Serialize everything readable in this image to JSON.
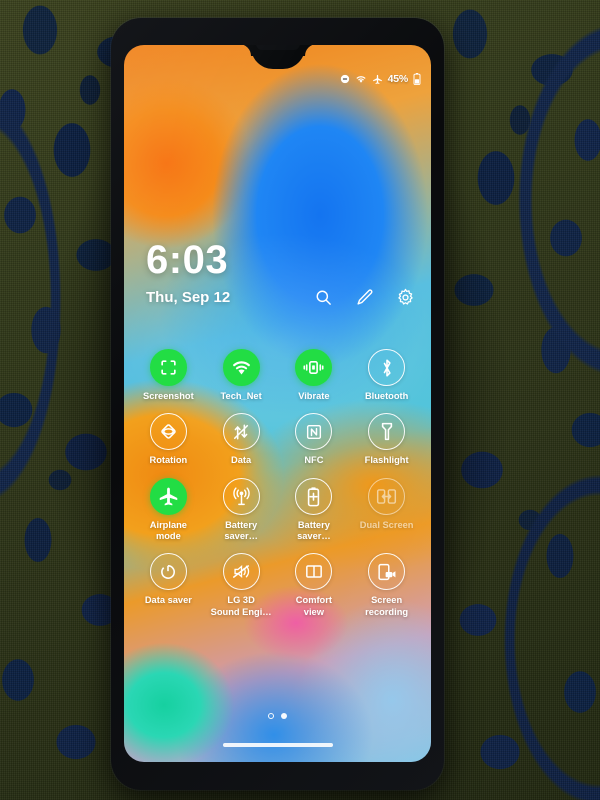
{
  "scene": {
    "description": "photo-of-phone-on-patterned-fabric",
    "background_colors": {
      "olive": "#333b1b",
      "navy": "#102346"
    }
  },
  "device": {
    "body_color": "#0b0d10",
    "notch_type": "waterdrop-notch"
  },
  "statusbar": {
    "icons": [
      "dnd-icon",
      "wifi-icon",
      "airplane-icon"
    ],
    "battery_percent": "45%",
    "battery_icon": "battery-icon"
  },
  "lockscreen": {
    "time": "6:03",
    "date": "Thu, Sep 12",
    "header_actions": [
      {
        "name": "search-icon",
        "label": "Search"
      },
      {
        "name": "edit-icon",
        "label": "Edit"
      },
      {
        "name": "settings-icon",
        "label": "Settings"
      }
    ]
  },
  "quick_settings": {
    "accent_on_color": "#22dd44",
    "tiles": [
      {
        "label": "Screenshot",
        "icon": "screenshot-icon",
        "state": "on",
        "dim": false
      },
      {
        "label": "Tech_Net",
        "icon": "wifi-icon",
        "state": "on",
        "dim": false
      },
      {
        "label": "Vibrate",
        "icon": "vibrate-icon",
        "state": "on",
        "dim": false
      },
      {
        "label": "Bluetooth",
        "icon": "bluetooth-icon",
        "state": "off",
        "dim": false
      },
      {
        "label": "Rotation",
        "icon": "rotation-icon",
        "state": "off",
        "dim": false
      },
      {
        "label": "Data",
        "icon": "data-off-icon",
        "state": "off",
        "dim": false
      },
      {
        "label": "NFC",
        "icon": "nfc-icon",
        "state": "off",
        "dim": false
      },
      {
        "label": "Flashlight",
        "icon": "flashlight-icon",
        "state": "off",
        "dim": false
      },
      {
        "label": "Airplane\nmode",
        "icon": "airplane-icon",
        "state": "on",
        "dim": false
      },
      {
        "label": "Hotspot",
        "icon": "hotspot-icon",
        "state": "off",
        "dim": false
      },
      {
        "label": "Battery\nsaver…",
        "icon": "battery-saver-icon",
        "state": "off",
        "dim": false
      },
      {
        "label": "Dual Screen",
        "icon": "dual-screen-icon",
        "state": "disabled",
        "dim": true
      },
      {
        "label": "Data saver",
        "icon": "data-saver-icon",
        "state": "off",
        "dim": false
      },
      {
        "label": "LG 3D\nSound Engi…",
        "icon": "sound-off-icon",
        "state": "off",
        "dim": false
      },
      {
        "label": "Comfort\nview",
        "icon": "comfort-view-icon",
        "state": "off",
        "dim": false
      },
      {
        "label": "Screen\nrecording",
        "icon": "screen-record-icon",
        "state": "off",
        "dim": false
      }
    ]
  },
  "pagination": {
    "pages": 2,
    "current": 1
  },
  "navigation": {
    "home_bar": "gesture-home-bar"
  }
}
